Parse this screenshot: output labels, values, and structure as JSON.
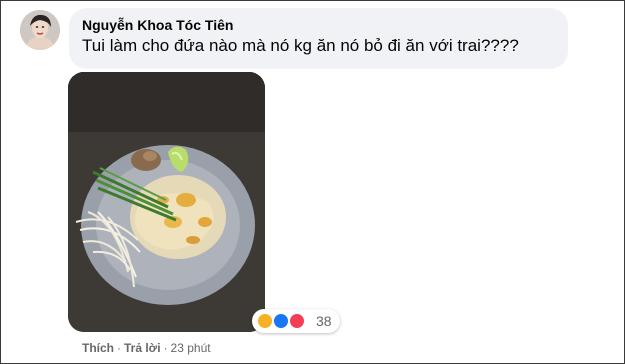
{
  "comment": {
    "author": "Nguyễn Khoa Tóc Tiên",
    "text": "Tui làm cho đứa nào mà nó kg ăn nó bỏ đi ăn với trai????",
    "attachment": {
      "icon": "food-photo"
    }
  },
  "reactions": {
    "icons": [
      "haha-emoji",
      "like-icon",
      "love-icon"
    ],
    "count": "38",
    "colors": {
      "haha": "#f7b125",
      "like": "#1877f2",
      "love": "#f33e58"
    }
  },
  "actions": {
    "like_label": "Thích",
    "separator": "·",
    "reply_label": "Trả lời",
    "time": "23 phút"
  }
}
